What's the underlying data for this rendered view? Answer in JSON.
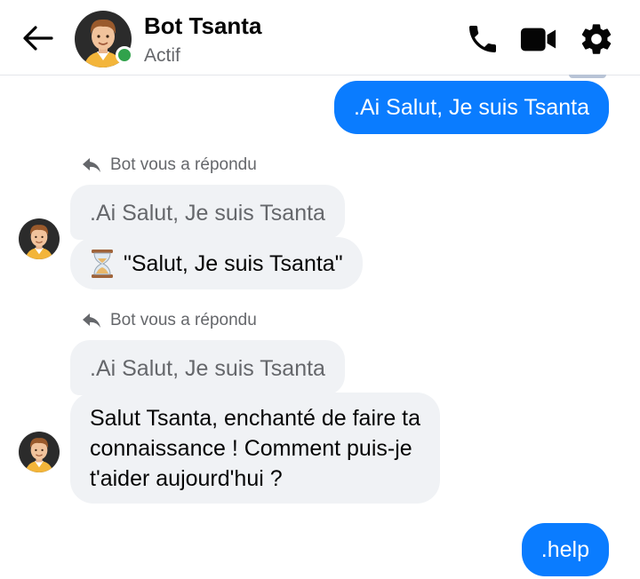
{
  "header": {
    "contact_name": "Bot Tsanta",
    "contact_status": "Actif",
    "icons": {
      "back": "arrow-left-icon",
      "call": "phone-icon",
      "video": "video-camera-icon",
      "settings": "gear-icon"
    }
  },
  "colors": {
    "accent": "#0a7cff",
    "incoming_bubble": "#f0f2f5",
    "online": "#31a24c",
    "secondary_text": "#65676b"
  },
  "messages": [
    {
      "direction": "outgoing",
      "text": ".Ai Salut, Je suis Tsanta"
    },
    {
      "direction": "incoming",
      "reply_label": "Bot vous a répondu",
      "quoted_text": ".Ai Salut, Je suis Tsanta",
      "text": "\"Salut, Je suis Tsanta\"",
      "prefix_emoji": "hourglass"
    },
    {
      "direction": "incoming",
      "reply_label": "Bot vous a répondu",
      "quoted_text": ".Ai Salut, Je suis Tsanta",
      "text_lines": [
        "Salut Tsanta, enchanté de faire ta",
        "connaissance ! Comment puis-je",
        "t'aider aujourd'hui ?"
      ]
    },
    {
      "direction": "outgoing",
      "text": ".help"
    }
  ]
}
